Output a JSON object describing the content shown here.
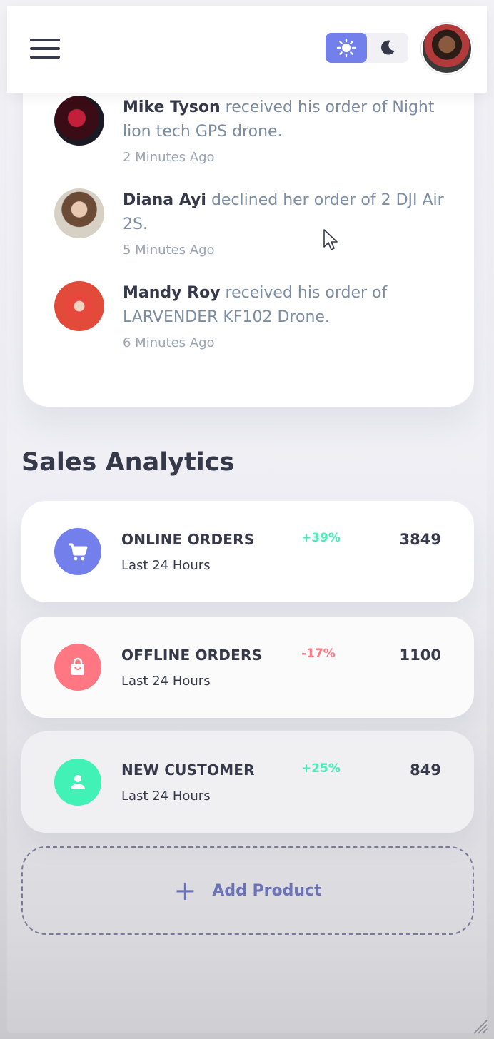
{
  "header": {
    "menu_icon": "hamburger-menu-icon",
    "theme_light_icon": "sun-icon",
    "theme_dark_icon": "moon-icon",
    "accent": "#7380ec"
  },
  "updates": [
    {
      "name": "Mike Tyson",
      "message": " received his order of Night lion tech GPS drone.",
      "time": "2 Minutes Ago"
    },
    {
      "name": "Diana Ayi",
      "message": " declined her order of 2 DJI Air 2S.",
      "time": "5 Minutes Ago"
    },
    {
      "name": "Mandy Roy",
      "message": " received his order of LARVENDER KF102 Drone.",
      "time": "6 Minutes Ago"
    }
  ],
  "sales": {
    "title": "Sales Analytics",
    "items": [
      {
        "title": "ONLINE ORDERS",
        "subtitle": "Last 24 Hours",
        "percent": "+39%",
        "value": "3849",
        "icon": "shopping-cart-icon",
        "color": "#7380ec",
        "percent_color": "#41f1b6"
      },
      {
        "title": "OFFLINE ORDERS",
        "subtitle": "Last 24 Hours",
        "percent": "-17%",
        "value": "1100",
        "icon": "shopping-bag-icon",
        "color": "#ff7782",
        "percent_color": "#ff7782"
      },
      {
        "title": "NEW CUSTOMER",
        "subtitle": "Last 24 Hours",
        "percent": "+25%",
        "value": "849",
        "icon": "person-icon",
        "color": "#41f1b6",
        "percent_color": "#41f1b6"
      }
    ]
  },
  "add_product": {
    "label": "Add Product",
    "icon": "plus-icon"
  }
}
